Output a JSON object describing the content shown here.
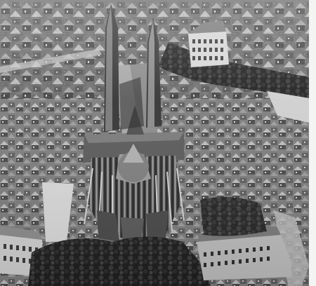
{
  "photo": {
    "subject": "aerial-city-cathedral",
    "tone": "monochrome"
  },
  "colors": {
    "paper": "#f4f4f2",
    "dark": "#1c1c1c",
    "mid": "#6e6e6e",
    "light": "#b9b9b9",
    "roof": "#8a8a8a",
    "trees": "#262626"
  }
}
